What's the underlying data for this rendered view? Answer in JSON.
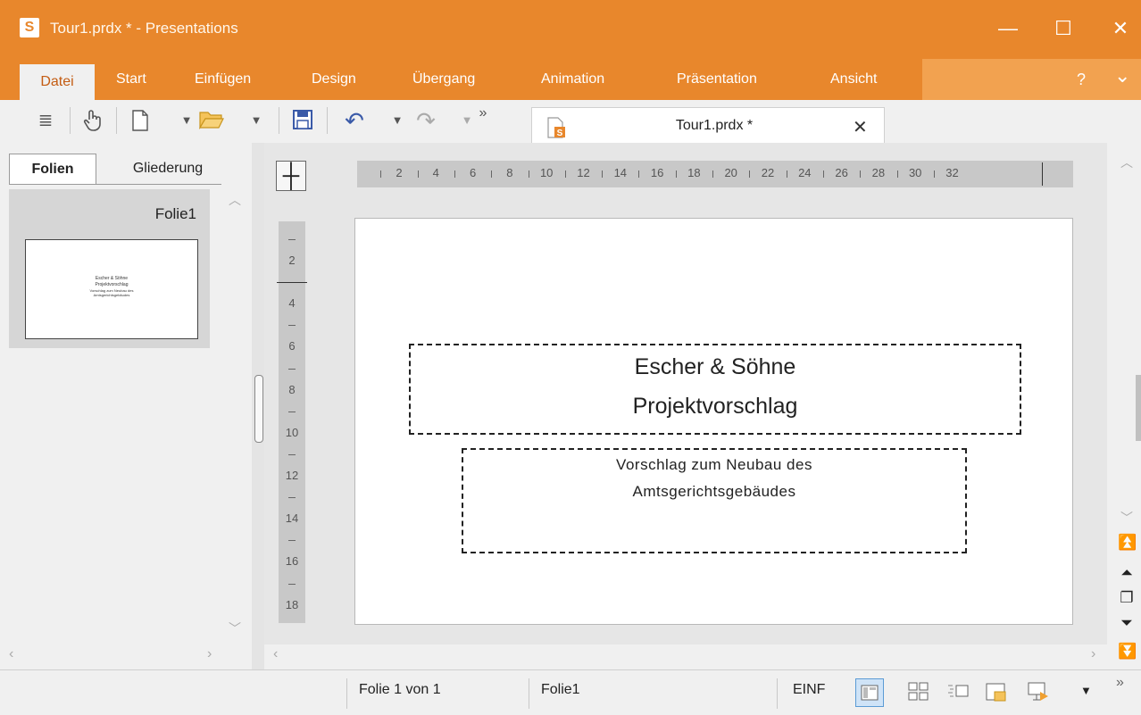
{
  "window": {
    "app_icon_letter": "S",
    "title": "Tour1.prdx * - Presentations",
    "minimize_glyph": "—",
    "maximize_glyph": "☐",
    "close_glyph": "✕"
  },
  "menu": {
    "items": [
      "Datei",
      "Start",
      "Einfügen",
      "Design",
      "Übergang",
      "Animation",
      "Präsentation",
      "Ansicht"
    ],
    "help": "?",
    "collapse": "⌄"
  },
  "toolbar": {
    "icons": [
      "hamburger-icon",
      "touch-hand-icon",
      "new-document-icon",
      "open-folder-icon",
      "save-icon",
      "undo-icon",
      "redo-icon",
      "overflow-icon"
    ],
    "overflow": "»",
    "doc_tab_label": "Tour1.prdx *",
    "doc_tab_close": "✕"
  },
  "left_panel": {
    "tabs": [
      "Folien",
      "Gliederung"
    ],
    "thumbnail_name": "Folie1",
    "thumbnail_lines": [
      "Escher & Söhne",
      "Projektvorschlag",
      "Vorschlag zum Neubau des",
      "Amtsgerichtsgebäudes"
    ]
  },
  "rulers": {
    "horizontal": [
      "2",
      "4",
      "6",
      "8",
      "10",
      "12",
      "14",
      "16",
      "18",
      "20",
      "22",
      "24",
      "26",
      "28",
      "30",
      "32"
    ],
    "vertical": [
      "2",
      "4",
      "6",
      "8",
      "10",
      "12",
      "14",
      "16",
      "18"
    ]
  },
  "slide": {
    "title_lines": [
      "Escher & Söhne",
      "Projektvorschlag"
    ],
    "subtitle_lines": [
      "Vorschlag zum Neubau des",
      "Amtsgerichtsgebäudes"
    ]
  },
  "status": {
    "slide_count": "Folie 1 von 1",
    "slide_name": "Folie1",
    "mode": "EINF",
    "overflow": "»"
  },
  "colors": {
    "accent": "#e8872c",
    "menu_fold": "#f2a250"
  }
}
